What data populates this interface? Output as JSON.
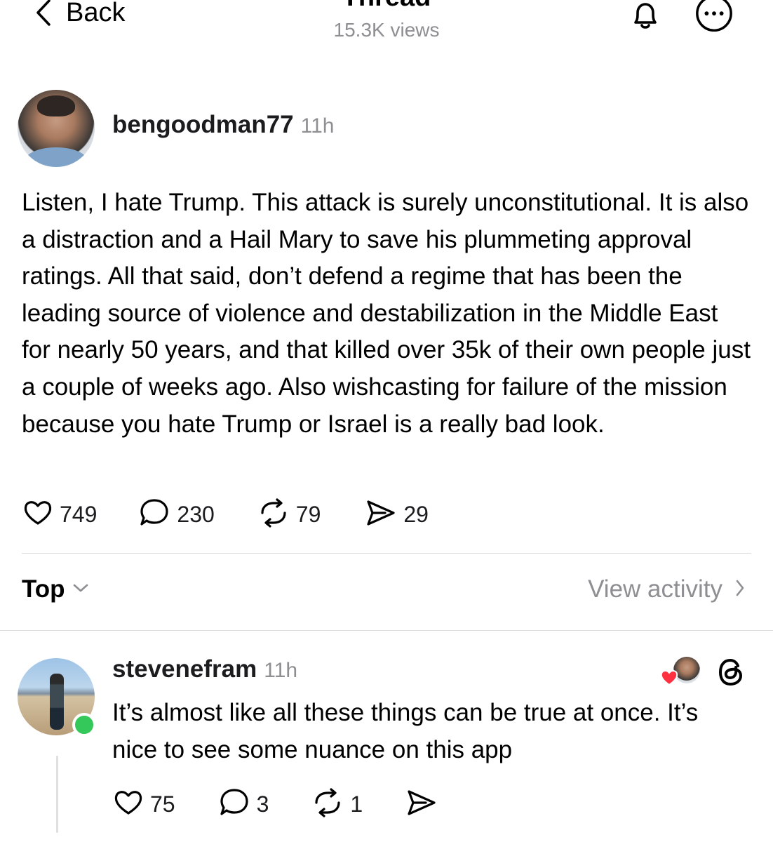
{
  "nav": {
    "back_label": "Back",
    "title": "Thread",
    "views": "15.3K views"
  },
  "post": {
    "username": "bengoodman77",
    "time": "11h",
    "body": "Listen, I hate Trump. This attack is surely unconstitutional. It is also a distraction and a Hail Mary to save his plummeting approval ratings. All that said, don’t defend a regime that has been the leading source of violence and destabilization in the Middle East for nearly 50 years, and that killed over 35k of their own people just a couple of weeks ago. Also wishcasting for failure of the mission because you hate Trump or Israel is a really bad look.",
    "likes": "749",
    "replies": "230",
    "reposts": "79",
    "shares": "29"
  },
  "sort": {
    "label": "Top",
    "view_activity": "View activity"
  },
  "reply": {
    "username": "stevenefram",
    "time": "11h",
    "body": "It’s almost like all these things can be true at once. It’s nice to see some nuance on this app",
    "likes": "75",
    "replies": "3",
    "reposts": "1",
    "liked_by_author": true
  },
  "colors": {
    "text": "#000000",
    "secondary": "#8e8e93",
    "divider": "#dcdcdc",
    "online": "#34c759",
    "heart": "#ff3040"
  },
  "icons": [
    "chevron-left-icon",
    "bell-icon",
    "more-icon",
    "heart-icon",
    "comment-icon",
    "repost-icon",
    "send-icon",
    "chevron-down-icon",
    "chevron-right-icon",
    "threads-logo-icon"
  ]
}
